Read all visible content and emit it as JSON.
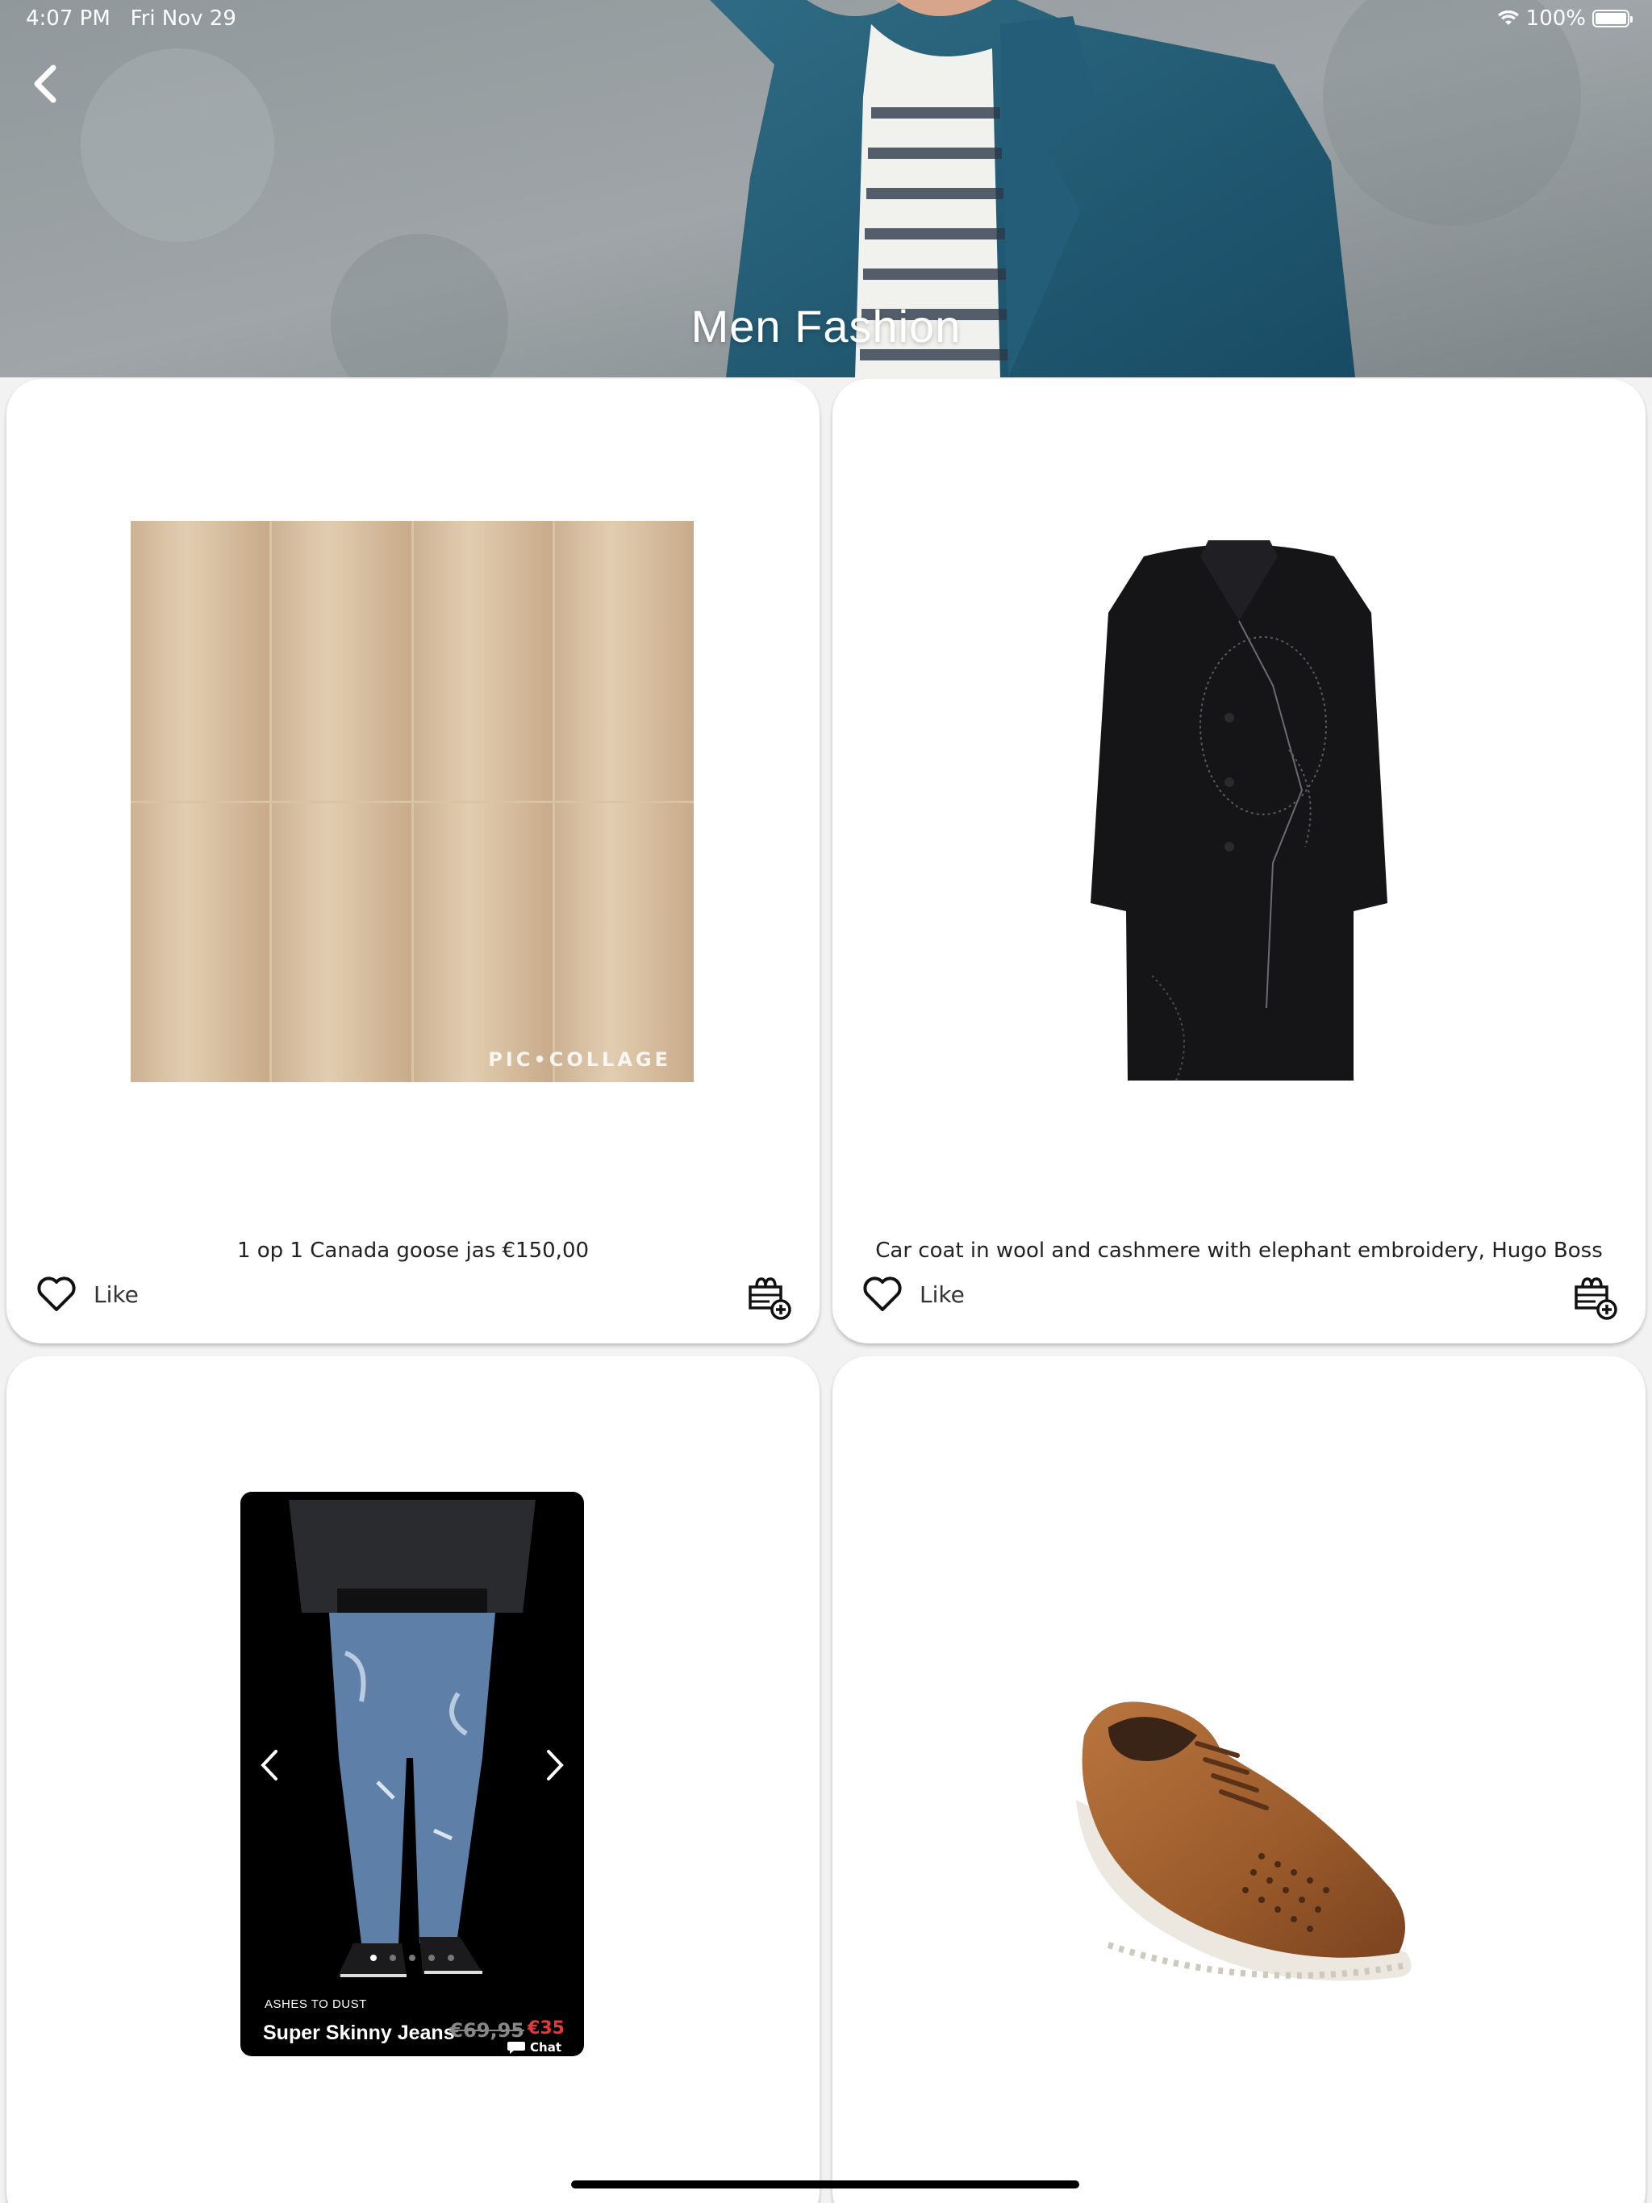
{
  "status_bar": {
    "time": "4:07 PM",
    "date": "Fri Nov 29",
    "battery": "100%",
    "icons": [
      "wifi-icon",
      "battery-icon"
    ]
  },
  "header": {
    "title": "Men Fashion",
    "back_icon": "chevron-left-icon"
  },
  "products": [
    {
      "title": "1 op 1 Canada goose jas  €150,00",
      "like_label": "Like",
      "image_watermark": "PIC•COLLAGE"
    },
    {
      "title": "Car coat in wool and cashmere with elephant embroidery, Hugo Boss",
      "like_label": "Like"
    },
    {
      "story": {
        "brand": "ASHES TO DUST",
        "name": "Super Skinny Jeans",
        "old_price": "€69,95",
        "new_price": "€35",
        "chat_label": "Chat",
        "slide_count": 5,
        "active_slide": 1
      }
    },
    {}
  ],
  "colors": {
    "card_background": "#ffffff",
    "page_background": "#f2f2f2",
    "sale_price": "#e63a3a"
  }
}
